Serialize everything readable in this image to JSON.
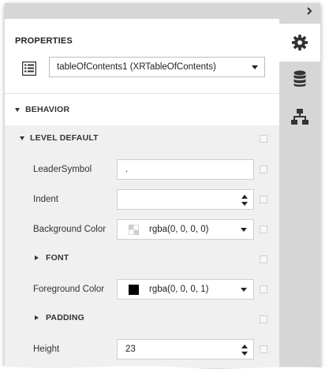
{
  "panel": {
    "title": "PROPERTIES",
    "selector": {
      "value": "tableOfContents1 (XRTableOfContents)"
    }
  },
  "side_tabs": [
    {
      "name": "properties",
      "icon": "gear-icon",
      "active": true
    },
    {
      "name": "field-list",
      "icon": "database-icon",
      "active": false
    },
    {
      "name": "report-explorer",
      "icon": "hierarchy-icon",
      "active": false
    }
  ],
  "sections": {
    "behavior": "BEHAVIOR",
    "level_default": "LEVEL DEFAULT",
    "font": "FONT",
    "padding": "PADDING"
  },
  "properties": {
    "leader_symbol": {
      "label": "LeaderSymbol",
      "value": "."
    },
    "indent": {
      "label": "Indent",
      "value": ""
    },
    "background_color": {
      "label": "Background Color",
      "value": "rgba(0, 0, 0, 0)"
    },
    "foreground_color": {
      "label": "Foreground Color",
      "value": "rgba(0, 0, 0, 1)",
      "swatch": "#000000"
    },
    "height": {
      "label": "Height",
      "value": "23"
    }
  },
  "colors": {
    "panel_bg": "#ffffff",
    "sidebar_bg": "#d6d6d6",
    "grid_bg": "#f0f0f0"
  }
}
